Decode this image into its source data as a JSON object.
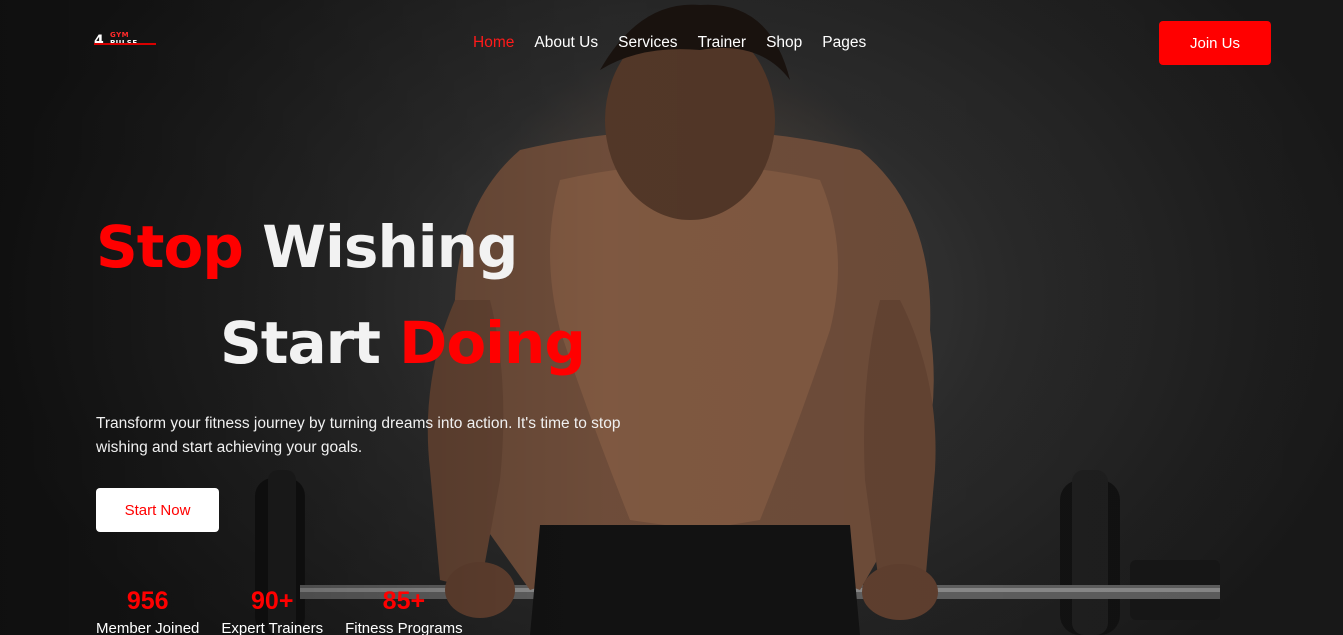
{
  "brand": {
    "logo_top": "GYM",
    "logo_bottom": "PULSE"
  },
  "nav": {
    "items": [
      {
        "label": "Home",
        "active": true
      },
      {
        "label": "About Us",
        "active": false
      },
      {
        "label": "Services",
        "active": false
      },
      {
        "label": "Trainer",
        "active": false
      },
      {
        "label": "Shop",
        "active": false
      },
      {
        "label": "Pages",
        "active": false
      }
    ],
    "join_label": "Join Us"
  },
  "hero": {
    "line1_red": "Stop",
    "line1_white": "Wishing",
    "line2_white": "Start",
    "line2_red": "Doing",
    "subtitle": "Transform your fitness journey by turning dreams into action. It's time to stop wishing and start achieving your goals.",
    "cta_label": "Start Now"
  },
  "stats": [
    {
      "value": "956",
      "label": "Member Joined"
    },
    {
      "value": "90+",
      "label": "Expert Trainers"
    },
    {
      "value": "85+",
      "label": "Fitness Programs"
    }
  ],
  "colors": {
    "accent": "#ff0000",
    "background": "#2b2b2b",
    "text": "#ffffff"
  }
}
